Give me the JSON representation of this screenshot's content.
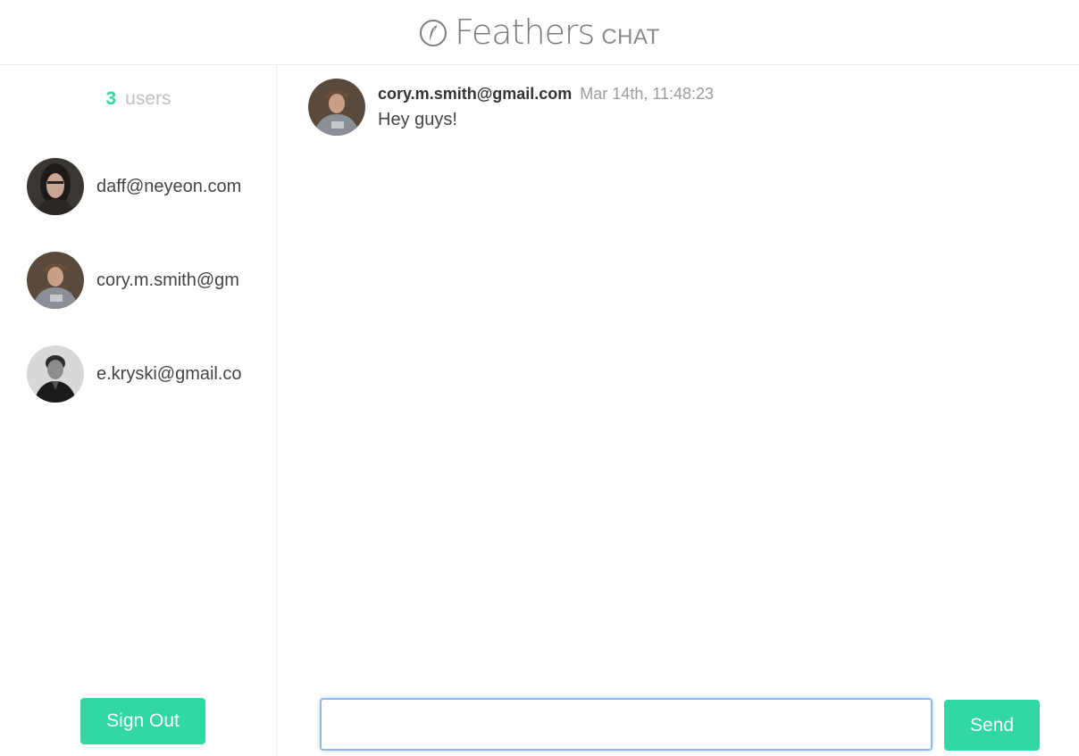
{
  "header": {
    "logo_icon": "feather-icon",
    "brand_name": "Feathers",
    "brand_sub": "CHAT"
  },
  "sidebar": {
    "user_count": "3",
    "user_count_label": "users",
    "users": [
      {
        "email": "daff@neyeon.com",
        "avatar": "avatar-long-hair"
      },
      {
        "email": "cory.m.smith@gm",
        "avatar": "avatar-cap"
      },
      {
        "email": "e.kryski@gmail.co",
        "avatar": "avatar-short-hair"
      }
    ],
    "signout_label": "Sign Out"
  },
  "messages": [
    {
      "author": "cory.m.smith@gmail.com",
      "time": "Mar 14th, 11:48:23",
      "text": "Hey guys!",
      "avatar": "avatar-cap"
    }
  ],
  "compose": {
    "input_value": "",
    "send_label": "Send"
  },
  "colors": {
    "accent": "#31d8a4",
    "input_focus": "#8fb9ea"
  }
}
